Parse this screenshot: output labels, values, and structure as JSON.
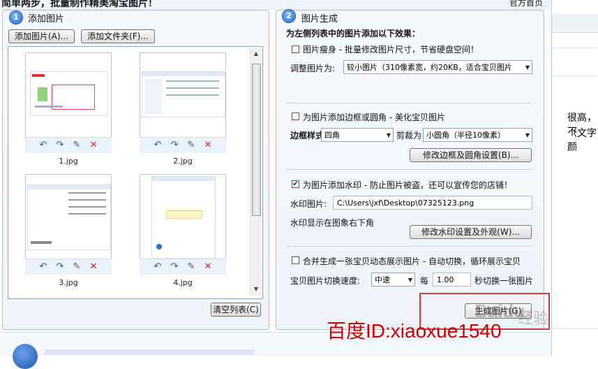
{
  "window": {
    "title": "简单两步，批量制作精美淘宝图片！",
    "top_right_link": "官方首页"
  },
  "left_panel": {
    "step": "1",
    "title": "添加图片",
    "add_images_button": "添加图片(A)...",
    "add_folder_button": "添加文件夹(F)...",
    "clear_list_button": "清空列表(C)",
    "thumbnails": [
      {
        "caption": "1.jpg"
      },
      {
        "caption": "2.jpg"
      },
      {
        "caption": "3.jpg"
      },
      {
        "caption": "4.jpg"
      }
    ],
    "tool_icons": [
      "rotate-left-icon",
      "rotate-right-icon",
      "edit-icon",
      "delete-icon"
    ]
  },
  "right_panel": {
    "step": "2",
    "title": "图片生成",
    "heading": "为左侧列表中的图片添加以下效果：",
    "slim": {
      "checked": false,
      "label": "图片瘦身 - 批量修改图片尺寸，节省硬盘空间！",
      "resize_label": "调整图片为:",
      "resize_value": "较小图片（310像素宽，约20KB，适合宝贝图片"
    },
    "border": {
      "checked": false,
      "label": "为图片添加边框或圆角 - 美化宝贝图片",
      "style_label": "边框样式",
      "style_value": "四角",
      "crop_label": "剪裁为",
      "crop_value": "小圆角（半径10像素）",
      "settings_button": "修改边框及圆角设置(B)..."
    },
    "watermark": {
      "checked": true,
      "label": "为图片添加水印 - 防止图片被盗，还可以宣传您的店铺！",
      "image_label": "水印图片:",
      "image_path": "C:\\Users\\jxf\\Desktop\\07325123.png",
      "position_text": "水印显示在图象右下角",
      "settings_button": "修改水印设置及外观(W)..."
    },
    "animation": {
      "checked": false,
      "label": "合并生成一张宝贝动态展示图片 - 自动切换，循环展示宝贝",
      "speed_label": "宝贝图片切换速度:",
      "speed_value": "中速",
      "every_label": "每",
      "seconds_value": "1.00",
      "seconds_suffix": "秒切换一张图片"
    },
    "generate_button": "生成图片(G)"
  },
  "background_text": {
    "line1": "很高，不",
    "line2": "（文字颜"
  },
  "overlay": {
    "watermark_text": "百度ID:xiaoxue1540",
    "baidu_logo_text": "Baidu",
    "baidu_suffix": "经验"
  },
  "colors": {
    "panel_border": "#a7b9d4",
    "accent_blue": "#2a6fd1",
    "annotation_red": "#d43a3a",
    "watermark_red": "#d10000"
  }
}
